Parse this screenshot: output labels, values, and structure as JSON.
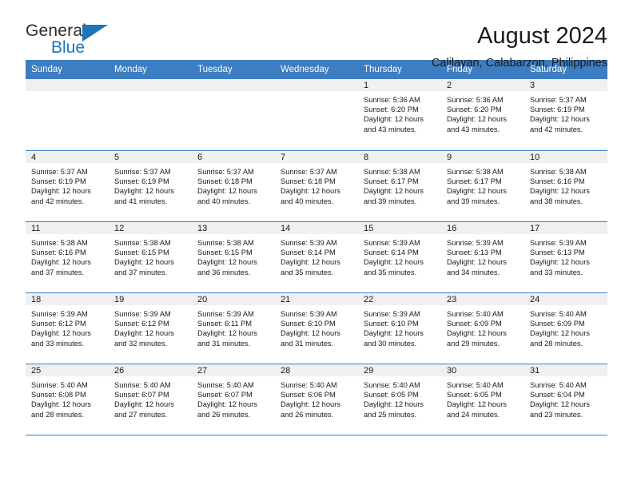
{
  "logo": {
    "word_one": "General",
    "word_two": "Blue",
    "triangle_icon": "triangle-icon",
    "brand_color": "#1b75bb"
  },
  "header": {
    "title": "August 2024",
    "subtitle": "Calilayan, Calabarzon, Philippines"
  },
  "theme": {
    "header_bg": "#3d7dc1",
    "header_text": "#ffffff",
    "daynum_band_bg": "#f0f0f0",
    "row_rule": "#3d7dc1"
  },
  "weekday_headers": [
    "Sunday",
    "Monday",
    "Tuesday",
    "Wednesday",
    "Thursday",
    "Friday",
    "Saturday"
  ],
  "weeks": [
    [
      {
        "day": "",
        "empty": true
      },
      {
        "day": "",
        "empty": true
      },
      {
        "day": "",
        "empty": true
      },
      {
        "day": "",
        "empty": true
      },
      {
        "day": "1",
        "sunrise": "Sunrise: 5:36 AM",
        "sunset": "Sunset: 6:20 PM",
        "daylight_line1": "Daylight: 12 hours",
        "daylight_line2": "and 43 minutes."
      },
      {
        "day": "2",
        "sunrise": "Sunrise: 5:36 AM",
        "sunset": "Sunset: 6:20 PM",
        "daylight_line1": "Daylight: 12 hours",
        "daylight_line2": "and 43 minutes."
      },
      {
        "day": "3",
        "sunrise": "Sunrise: 5:37 AM",
        "sunset": "Sunset: 6:19 PM",
        "daylight_line1": "Daylight: 12 hours",
        "daylight_line2": "and 42 minutes."
      }
    ],
    [
      {
        "day": "4",
        "sunrise": "Sunrise: 5:37 AM",
        "sunset": "Sunset: 6:19 PM",
        "daylight_line1": "Daylight: 12 hours",
        "daylight_line2": "and 42 minutes."
      },
      {
        "day": "5",
        "sunrise": "Sunrise: 5:37 AM",
        "sunset": "Sunset: 6:19 PM",
        "daylight_line1": "Daylight: 12 hours",
        "daylight_line2": "and 41 minutes."
      },
      {
        "day": "6",
        "sunrise": "Sunrise: 5:37 AM",
        "sunset": "Sunset: 6:18 PM",
        "daylight_line1": "Daylight: 12 hours",
        "daylight_line2": "and 40 minutes."
      },
      {
        "day": "7",
        "sunrise": "Sunrise: 5:37 AM",
        "sunset": "Sunset: 6:18 PM",
        "daylight_line1": "Daylight: 12 hours",
        "daylight_line2": "and 40 minutes."
      },
      {
        "day": "8",
        "sunrise": "Sunrise: 5:38 AM",
        "sunset": "Sunset: 6:17 PM",
        "daylight_line1": "Daylight: 12 hours",
        "daylight_line2": "and 39 minutes."
      },
      {
        "day": "9",
        "sunrise": "Sunrise: 5:38 AM",
        "sunset": "Sunset: 6:17 PM",
        "daylight_line1": "Daylight: 12 hours",
        "daylight_line2": "and 39 minutes."
      },
      {
        "day": "10",
        "sunrise": "Sunrise: 5:38 AM",
        "sunset": "Sunset: 6:16 PM",
        "daylight_line1": "Daylight: 12 hours",
        "daylight_line2": "and 38 minutes."
      }
    ],
    [
      {
        "day": "11",
        "sunrise": "Sunrise: 5:38 AM",
        "sunset": "Sunset: 6:16 PM",
        "daylight_line1": "Daylight: 12 hours",
        "daylight_line2": "and 37 minutes."
      },
      {
        "day": "12",
        "sunrise": "Sunrise: 5:38 AM",
        "sunset": "Sunset: 6:15 PM",
        "daylight_line1": "Daylight: 12 hours",
        "daylight_line2": "and 37 minutes."
      },
      {
        "day": "13",
        "sunrise": "Sunrise: 5:38 AM",
        "sunset": "Sunset: 6:15 PM",
        "daylight_line1": "Daylight: 12 hours",
        "daylight_line2": "and 36 minutes."
      },
      {
        "day": "14",
        "sunrise": "Sunrise: 5:39 AM",
        "sunset": "Sunset: 6:14 PM",
        "daylight_line1": "Daylight: 12 hours",
        "daylight_line2": "and 35 minutes."
      },
      {
        "day": "15",
        "sunrise": "Sunrise: 5:39 AM",
        "sunset": "Sunset: 6:14 PM",
        "daylight_line1": "Daylight: 12 hours",
        "daylight_line2": "and 35 minutes."
      },
      {
        "day": "16",
        "sunrise": "Sunrise: 5:39 AM",
        "sunset": "Sunset: 6:13 PM",
        "daylight_line1": "Daylight: 12 hours",
        "daylight_line2": "and 34 minutes."
      },
      {
        "day": "17",
        "sunrise": "Sunrise: 5:39 AM",
        "sunset": "Sunset: 6:13 PM",
        "daylight_line1": "Daylight: 12 hours",
        "daylight_line2": "and 33 minutes."
      }
    ],
    [
      {
        "day": "18",
        "sunrise": "Sunrise: 5:39 AM",
        "sunset": "Sunset: 6:12 PM",
        "daylight_line1": "Daylight: 12 hours",
        "daylight_line2": "and 33 minutes."
      },
      {
        "day": "19",
        "sunrise": "Sunrise: 5:39 AM",
        "sunset": "Sunset: 6:12 PM",
        "daylight_line1": "Daylight: 12 hours",
        "daylight_line2": "and 32 minutes."
      },
      {
        "day": "20",
        "sunrise": "Sunrise: 5:39 AM",
        "sunset": "Sunset: 6:11 PM",
        "daylight_line1": "Daylight: 12 hours",
        "daylight_line2": "and 31 minutes."
      },
      {
        "day": "21",
        "sunrise": "Sunrise: 5:39 AM",
        "sunset": "Sunset: 6:10 PM",
        "daylight_line1": "Daylight: 12 hours",
        "daylight_line2": "and 31 minutes."
      },
      {
        "day": "22",
        "sunrise": "Sunrise: 5:39 AM",
        "sunset": "Sunset: 6:10 PM",
        "daylight_line1": "Daylight: 12 hours",
        "daylight_line2": "and 30 minutes."
      },
      {
        "day": "23",
        "sunrise": "Sunrise: 5:40 AM",
        "sunset": "Sunset: 6:09 PM",
        "daylight_line1": "Daylight: 12 hours",
        "daylight_line2": "and 29 minutes."
      },
      {
        "day": "24",
        "sunrise": "Sunrise: 5:40 AM",
        "sunset": "Sunset: 6:09 PM",
        "daylight_line1": "Daylight: 12 hours",
        "daylight_line2": "and 28 minutes."
      }
    ],
    [
      {
        "day": "25",
        "sunrise": "Sunrise: 5:40 AM",
        "sunset": "Sunset: 6:08 PM",
        "daylight_line1": "Daylight: 12 hours",
        "daylight_line2": "and 28 minutes."
      },
      {
        "day": "26",
        "sunrise": "Sunrise: 5:40 AM",
        "sunset": "Sunset: 6:07 PM",
        "daylight_line1": "Daylight: 12 hours",
        "daylight_line2": "and 27 minutes."
      },
      {
        "day": "27",
        "sunrise": "Sunrise: 5:40 AM",
        "sunset": "Sunset: 6:07 PM",
        "daylight_line1": "Daylight: 12 hours",
        "daylight_line2": "and 26 minutes."
      },
      {
        "day": "28",
        "sunrise": "Sunrise: 5:40 AM",
        "sunset": "Sunset: 6:06 PM",
        "daylight_line1": "Daylight: 12 hours",
        "daylight_line2": "and 26 minutes."
      },
      {
        "day": "29",
        "sunrise": "Sunrise: 5:40 AM",
        "sunset": "Sunset: 6:05 PM",
        "daylight_line1": "Daylight: 12 hours",
        "daylight_line2": "and 25 minutes."
      },
      {
        "day": "30",
        "sunrise": "Sunrise: 5:40 AM",
        "sunset": "Sunset: 6:05 PM",
        "daylight_line1": "Daylight: 12 hours",
        "daylight_line2": "and 24 minutes."
      },
      {
        "day": "31",
        "sunrise": "Sunrise: 5:40 AM",
        "sunset": "Sunset: 6:04 PM",
        "daylight_line1": "Daylight: 12 hours",
        "daylight_line2": "and 23 minutes."
      }
    ]
  ]
}
